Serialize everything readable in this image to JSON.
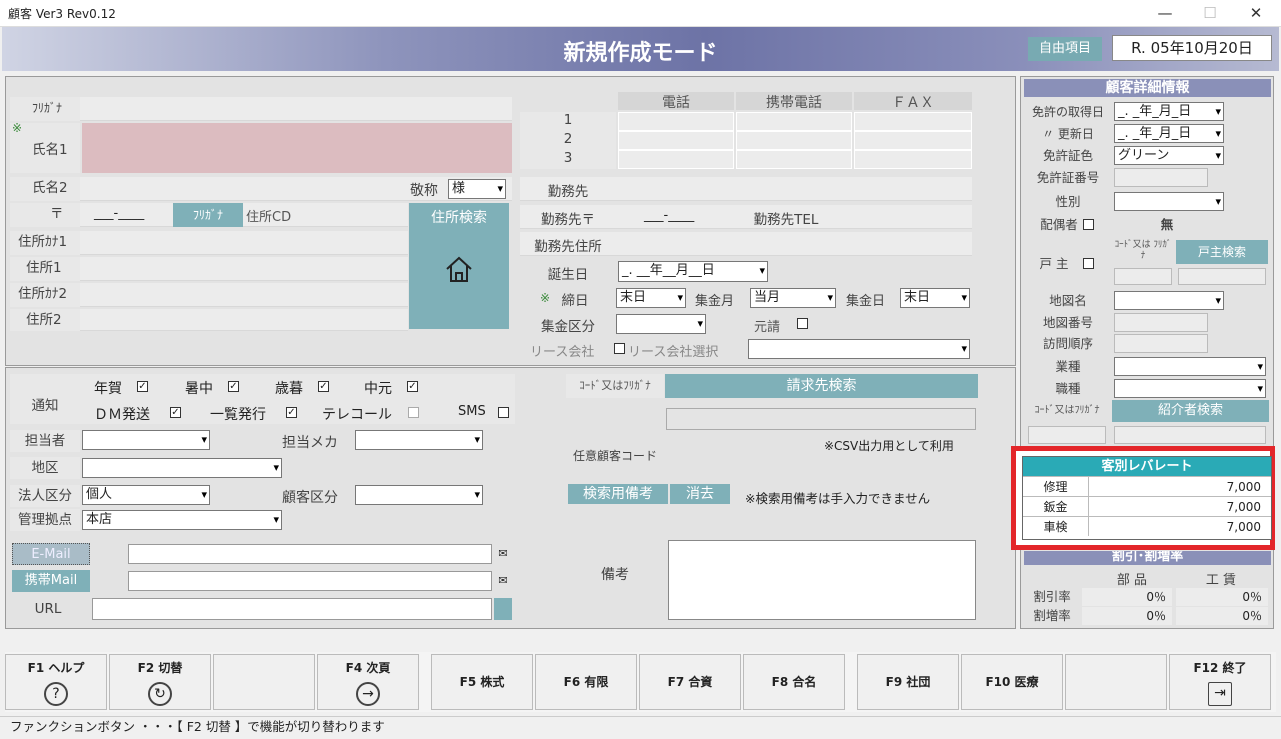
{
  "window": {
    "title": "顧客 Ver3 Rev0.12",
    "min": "—",
    "max": "☐",
    "close": "✕"
  },
  "header": {
    "mode": "新規作成モード",
    "free_item": "自由項目",
    "date": "R. 05年10月20日"
  },
  "customer": {
    "furigana_label": "ﾌﾘｶﾞﾅ",
    "name1_label": "氏名1",
    "required_mark": "※",
    "name2_label": "氏名2",
    "honorific_label": "敬称",
    "honorific_value": "様",
    "zip_label": "〒",
    "zip_value": "___-____",
    "furigana_btn": "ﾌﾘｶﾞﾅ",
    "address_cd": "住所CD",
    "address_search": "住所検索",
    "addr_kana1": "住所ｶﾅ1",
    "addr1": "住所1",
    "addr_kana2": "住所ｶﾅ2",
    "addr2": "住所2"
  },
  "phone": {
    "col_tel": "電話",
    "col_mobile": "携帯電話",
    "col_fax": "ＦＡＸ",
    "rows": [
      "1",
      "2",
      "3"
    ]
  },
  "work": {
    "company_label": "勤務先",
    "zip_label": "勤務先〒",
    "zip_value": "___-____",
    "tel_label": "勤務先TEL",
    "address_label": "勤務先住所",
    "birthday_label": "誕生日",
    "birthday_value": "_. __年__月__日",
    "close_label": "締日",
    "close_value": "末日",
    "collect_month_label": "集金月",
    "collect_month_value": "当月",
    "collect_day_label": "集金日",
    "collect_day_value": "末日",
    "collect_type_label": "集金区分",
    "motouke_label": "元請",
    "lease_label": "リース会社",
    "lease_select_label": "リース会社選択"
  },
  "notify": {
    "label": "通知",
    "items": [
      "年賀",
      "暑中",
      "歳暮",
      "中元",
      "ＤＭ発送",
      "一覧発行",
      "テレコール",
      "SMS"
    ],
    "checked": [
      "✓",
      "✓",
      "✓",
      "✓",
      "✓",
      "✓",
      "",
      ""
    ]
  },
  "misc": {
    "staff_label": "担当者",
    "staff_maker_label": "担当メカ",
    "area_label": "地区",
    "corp_label": "法人区分",
    "corp_value": "個人",
    "cust_type_label": "顧客区分",
    "base_label": "管理拠点",
    "base_value": "本店",
    "email_label": "E-Mail",
    "mobile_mail_label": "携帯Mail",
    "url_label": "URL"
  },
  "billing": {
    "code_label": "ｺｰﾄﾞ又はﾌﾘｶﾞﾅ",
    "search_btn": "請求先検索",
    "any_code_label": "任意顧客コード",
    "csv_note": "※CSV出力用として利用",
    "search_memo_btn": "検索用備考",
    "erase_btn": "消去",
    "memo_note": "※検索用備考は手入力できません",
    "remarks_label": "備考"
  },
  "detail": {
    "title": "顧客詳細情報",
    "license_date_label": "免許の取得日",
    "license_date_value": "_. _年_月_日",
    "renew_label": "〃 更新日",
    "renew_value": "_. _年_月_日",
    "license_color_label": "免許証色",
    "license_color_value": "グリーン",
    "license_no_label": "免許証番号",
    "gender_label": "性別",
    "spouse_label": "配偶者",
    "spouse_value": "無",
    "household_label": "戸 主",
    "code_kana_label": "ｺｰﾄﾞ又は ﾌﾘｶﾞﾅ",
    "household_search": "戸主検索",
    "map_name_label": "地図名",
    "map_no_label": "地図番号",
    "visit_order_label": "訪問順序",
    "industry_label": "業種",
    "job_label": "職種",
    "code_kana2": "ｺｰﾄﾞ又はﾌﾘｶﾞﾅ",
    "referrer_search": "紹介者検索"
  },
  "rate": {
    "title": "客別レバレート",
    "rows": [
      {
        "label": "修理",
        "value": "7,000"
      },
      {
        "label": "鈑金",
        "value": "7,000"
      },
      {
        "label": "車検",
        "value": "7,000"
      }
    ]
  },
  "discount": {
    "title": "割引･割増率",
    "col_parts": "部 品",
    "col_labor": "工 賃",
    "discount_label": "割引率",
    "premium_label": "割増率",
    "d_parts": "0％",
    "d_labor": "0％",
    "p_parts": "0％",
    "p_labor": "0％"
  },
  "fkeys": [
    {
      "label": "F1 ヘルプ",
      "icon": "?"
    },
    {
      "label": "F2 切替",
      "icon": "↻"
    },
    {
      "label": "",
      "icon": ""
    },
    {
      "label": "F4 次頁",
      "icon": "→"
    },
    {
      "label": "F5 株式",
      "icon": ""
    },
    {
      "label": "F6 有限",
      "icon": ""
    },
    {
      "label": "F7 合資",
      "icon": ""
    },
    {
      "label": "F8 合名",
      "icon": ""
    },
    {
      "label": "F9 社団",
      "icon": ""
    },
    {
      "label": "F10 医療",
      "icon": ""
    },
    {
      "label": "",
      "icon": ""
    },
    {
      "label": "F12 終了",
      "icon": "⇥"
    }
  ],
  "status": "ファンクションボタン ・・・【 F2 切替 】で機能が切り替わります"
}
